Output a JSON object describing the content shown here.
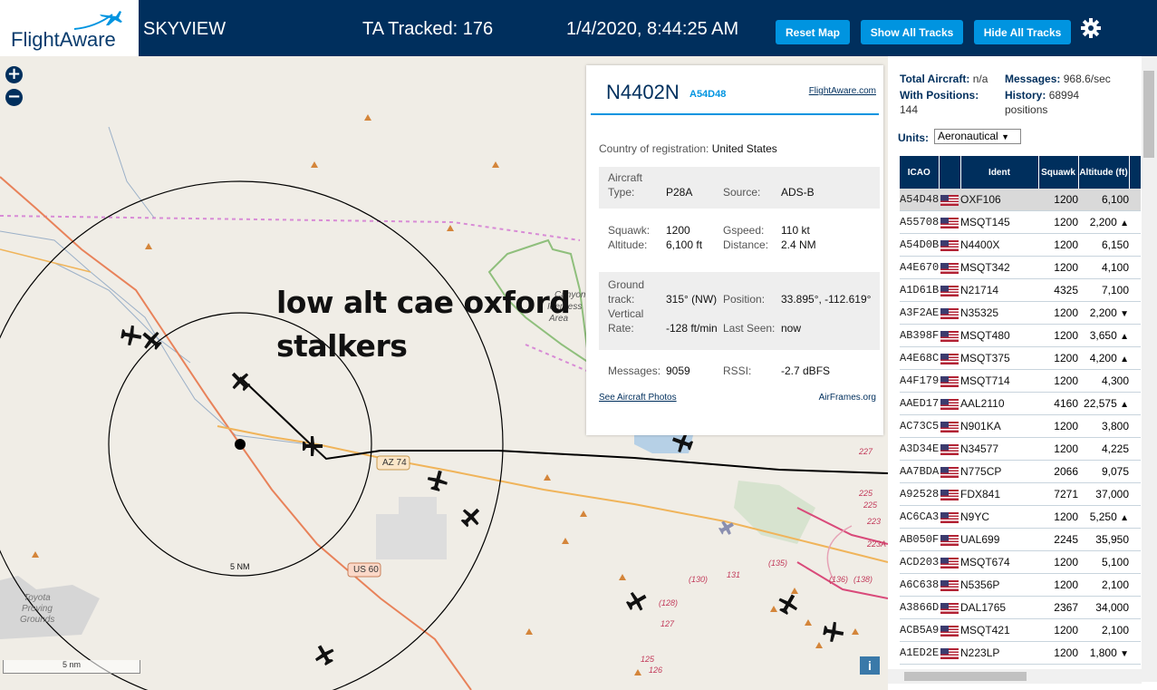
{
  "header": {
    "logo_text": "FlightAware",
    "app_name": "SKYVIEW",
    "tracked": "TA Tracked: 176",
    "datetime": "1/4/2020, 8:44:25 AM",
    "buttons": {
      "reset_map": "Reset Map",
      "show_all": "Show All Tracks",
      "hide_all": "Hide All Tracks"
    }
  },
  "map": {
    "annotation_line1": "low alt cae oxford",
    "annotation_line2": "stalkers",
    "ring_label": "5 NM",
    "scale_label": "5 nm",
    "road_labels": [
      "AZ 74",
      "US 60"
    ],
    "place_labels": [
      "Canyon",
      "Iderness",
      "Area",
      "Toyota",
      "Proving",
      "Grounds"
    ],
    "airway_labels": [
      "227",
      "225",
      "225",
      "223",
      "223A",
      "(130)",
      "131",
      "(135)",
      "(136)",
      "(138)",
      "(128)",
      "127",
      "125",
      "126",
      "(138)"
    ],
    "zoom_in": "+",
    "zoom_out": "−",
    "info_button": "i"
  },
  "popup": {
    "callsign": "N4402N",
    "hex": "A54D48",
    "fa_link": "FlightAware.com",
    "country_label": "Country of registration:",
    "country_value": "United States",
    "aircraft_type_label": "Aircraft Type:",
    "aircraft_type_label1": "Aircraft",
    "aircraft_type_label2": "Type:",
    "aircraft_type": "P28A",
    "source_label": "Source:",
    "source": "ADS-B",
    "squawk_label": "Squawk:",
    "squawk": "1200",
    "gspeed_label": "Gspeed:",
    "gspeed": "110 kt",
    "altitude_label": "Altitude:",
    "altitude": "6,100 ft",
    "distance_label": "Distance:",
    "distance": "2.4 NM",
    "ground_track_label1": "Ground",
    "ground_track_label2": "track:",
    "ground_track": "315° (NW)",
    "position_label": "Position:",
    "position": "33.895°, -112.619°",
    "vrate_label1": "Vertical",
    "vrate_label2": "Rate:",
    "vrate": "-128 ft/min",
    "last_seen_label": "Last Seen:",
    "last_seen": "now",
    "messages_label": "Messages:",
    "messages": "9059",
    "rssi_label": "RSSI:",
    "rssi": "-2.7 dBFS",
    "photos_link": "See Aircraft Photos",
    "airframes_link": "AirFrames.org"
  },
  "sidebar": {
    "total_label": "Total Aircraft:",
    "total_value": "n/a",
    "positions_label": "With Positions:",
    "positions_value": "144",
    "messages_label": "Messages:",
    "messages_value": "968.6/sec",
    "history_label": "History:",
    "history_value": "68994",
    "history_unit": "positions",
    "units_label": "Units:",
    "units_value": "Aeronautical",
    "columns": {
      "icao": "ICAO",
      "ident": "Ident",
      "squawk": "Squawk",
      "altitude": "Altitude (ft)"
    },
    "rows": [
      {
        "icao": "A54D48",
        "ident": "OXF106",
        "squawk": "1200",
        "alt": "6,100",
        "trend": ""
      },
      {
        "icao": "A55708",
        "ident": "MSQT145",
        "squawk": "1200",
        "alt": "2,200",
        "trend": "▲"
      },
      {
        "icao": "A54D0B",
        "ident": "N4400X",
        "squawk": "1200",
        "alt": "6,150",
        "trend": ""
      },
      {
        "icao": "A4E670",
        "ident": "MSQT342",
        "squawk": "1200",
        "alt": "4,100",
        "trend": ""
      },
      {
        "icao": "A1D61B",
        "ident": "N21714",
        "squawk": "4325",
        "alt": "7,100",
        "trend": ""
      },
      {
        "icao": "A3F2AE",
        "ident": "N35325",
        "squawk": "1200",
        "alt": "2,200",
        "trend": "▼"
      },
      {
        "icao": "AB398F",
        "ident": "MSQT480",
        "squawk": "1200",
        "alt": "3,650",
        "trend": "▲"
      },
      {
        "icao": "A4E68C",
        "ident": "MSQT375",
        "squawk": "1200",
        "alt": "4,200",
        "trend": "▲"
      },
      {
        "icao": "A4F179",
        "ident": "MSQT714",
        "squawk": "1200",
        "alt": "4,300",
        "trend": ""
      },
      {
        "icao": "AAED17",
        "ident": "AAL2110",
        "squawk": "4160",
        "alt": "22,575",
        "trend": "▲"
      },
      {
        "icao": "AC73C5",
        "ident": "N901KA",
        "squawk": "1200",
        "alt": "3,800",
        "trend": ""
      },
      {
        "icao": "A3D34E",
        "ident": "N34577",
        "squawk": "1200",
        "alt": "4,225",
        "trend": ""
      },
      {
        "icao": "AA7BDA",
        "ident": "N775CP",
        "squawk": "2066",
        "alt": "9,075",
        "trend": ""
      },
      {
        "icao": "A92528",
        "ident": "FDX841",
        "squawk": "7271",
        "alt": "37,000",
        "trend": ""
      },
      {
        "icao": "AC6CA3",
        "ident": "N9YC",
        "squawk": "1200",
        "alt": "5,250",
        "trend": "▲"
      },
      {
        "icao": "AB050F",
        "ident": "UAL699",
        "squawk": "2245",
        "alt": "35,950",
        "trend": ""
      },
      {
        "icao": "ACD203",
        "ident": "MSQT674",
        "squawk": "1200",
        "alt": "5,100",
        "trend": ""
      },
      {
        "icao": "A6C638",
        "ident": "N5356P",
        "squawk": "1200",
        "alt": "2,100",
        "trend": ""
      },
      {
        "icao": "A3866D",
        "ident": "DAL1765",
        "squawk": "2367",
        "alt": "34,000",
        "trend": ""
      },
      {
        "icao": "ACB5A9",
        "ident": "MSQT421",
        "squawk": "1200",
        "alt": "2,100",
        "trend": ""
      },
      {
        "icao": "A1ED2E",
        "ident": "N223LP",
        "squawk": "1200",
        "alt": "1,800",
        "trend": "▼"
      }
    ]
  },
  "colors": {
    "header_bg": "#002f5d",
    "accent": "#0094e0",
    "route_orange": "#e8825a"
  }
}
